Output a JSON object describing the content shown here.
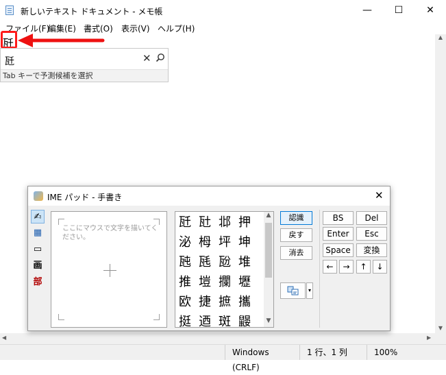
{
  "window": {
    "title": "新しいテキスト ドキュメント - メモ帳"
  },
  "window_controls": {
    "minimize": "—",
    "maximize": "☐",
    "close": "✕"
  },
  "menu": {
    "items": [
      "ファイル(F)",
      "編集(E)",
      "書式(O)",
      "表示(V)",
      "ヘルプ(H)"
    ]
  },
  "editor": {
    "text": "瓩"
  },
  "candidate": {
    "text": "瓩",
    "close": "✕",
    "hint": "Tab キーで予測候補を選択"
  },
  "status": {
    "line_ending": "Windows (CRLF)",
    "position": "1 行、1 列",
    "zoom": "100%"
  },
  "imepad": {
    "title": "IME パッド - 手書き",
    "close": "✕",
    "sidebar": [
      "✍",
      "▦",
      "▭",
      "画",
      "部"
    ],
    "draw_hint": "ここにマウスで文字を描いてください。",
    "candidates": [
      "瓩",
      "瓧",
      "邶",
      "押",
      "泌",
      "栂",
      "坪",
      "坤",
      "瓲",
      "瓱",
      "瓰",
      "堆",
      "推",
      "塏",
      "攔",
      "壢",
      "欧",
      "捷",
      "摭",
      "攜",
      "挺",
      "迺",
      "斑",
      "鼹"
    ],
    "buttons": {
      "recognize": "認識",
      "undo": "戻す",
      "clear": "消去"
    },
    "keys": {
      "bs": "BS",
      "del": "Del",
      "enter": "Enter",
      "esc": "Esc",
      "space": "Space",
      "convert": "変換",
      "left": "←",
      "right": "→",
      "up": "↑",
      "down": "↓"
    }
  },
  "colors": {
    "highlight": "#ff1a1a",
    "accent": "#0078d7"
  }
}
